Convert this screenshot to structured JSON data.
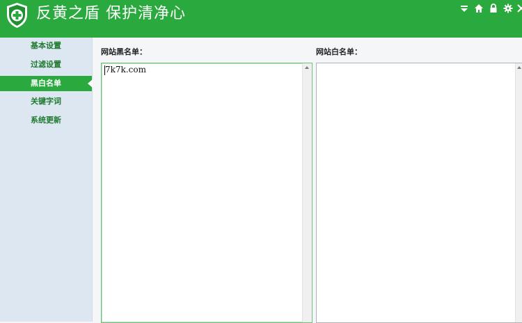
{
  "app": {
    "title": "反黄之盾  保护清净心",
    "brand_color": "#2aaa3e"
  },
  "header_icons": [
    "dropdown-icon",
    "home-icon",
    "lock-icon",
    "gear-icon",
    "close-icon"
  ],
  "sidebar": {
    "items": [
      {
        "label": "基本设置",
        "active": false
      },
      {
        "label": "过滤设置",
        "active": false
      },
      {
        "label": "黑白名单",
        "active": true
      },
      {
        "label": "关键字词",
        "active": false
      },
      {
        "label": "系统更新",
        "active": false
      }
    ]
  },
  "main": {
    "blacklist": {
      "label": "网站黑名单：",
      "entries": [
        "7k7k.com"
      ]
    },
    "whitelist": {
      "label": "网站白名单：",
      "entries": []
    }
  }
}
